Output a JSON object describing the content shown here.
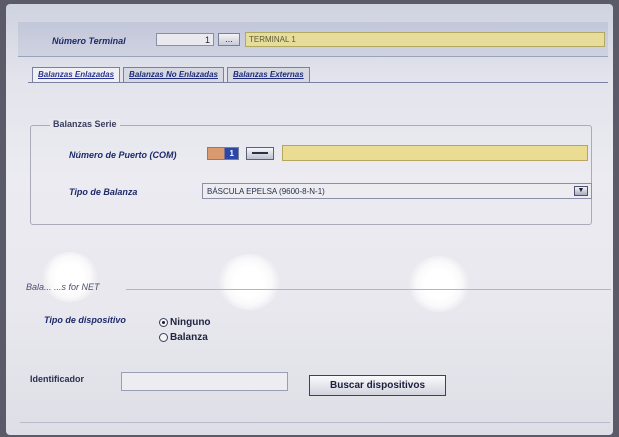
{
  "header": {
    "terminal_label": "Número Terminal",
    "terminal_number": "1",
    "terminal_button": "...",
    "terminal_name": "TERMINAL 1"
  },
  "tabs": [
    {
      "label": "Balanzas Enlazadas",
      "active": true
    },
    {
      "label": "Balanzas No Enlazadas",
      "active": false
    },
    {
      "label": "Balanzas Externas",
      "active": false
    }
  ],
  "serie": {
    "legend": "Balanzas Serie",
    "puerto_label": "Número de Puerto (COM)",
    "puerto_value": "1",
    "tipo_label": "Tipo de Balanza",
    "tipo_value": "BÁSCULA EPELSA (9600-8-N-1)"
  },
  "net": {
    "legend": "Bala... ...s for NET",
    "dispositivo_label": "Tipo de dispositivo",
    "options": [
      {
        "label": "Ninguno",
        "selected": true
      },
      {
        "label": "Balanza",
        "selected": false
      }
    ],
    "identificador_label": "Identificador",
    "identificador_value": "",
    "buscar_label": "Buscar dispositivos"
  },
  "colors": {
    "accent_yellow": "#ebdc94",
    "label_blue": "#1e2a6a",
    "port_blue": "#2b48a8"
  }
}
